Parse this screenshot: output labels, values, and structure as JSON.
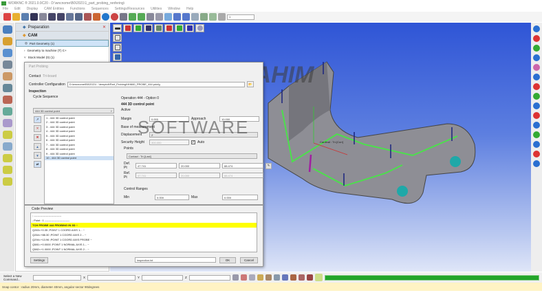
{
  "window": {
    "title": "WORKNC ® 2021.0.9C20 - D:\\wncnome\\B0\\2021\\1_part_probing_renfering\\"
  },
  "menu": [
    "File",
    "Edit",
    "Display",
    "CAM Entities",
    "Functions",
    "Sequences",
    "Settings/Resources",
    "Utilities",
    "Window",
    "Help"
  ],
  "toolbar": {
    "layer_select": "1"
  },
  "tree": {
    "preparation": "Preparation",
    "cam": "CAM",
    "items": [
      "Part Geometry (1)",
      "Geometry to machine (T) C+",
      "Stock Model (0) (1)",
      "Part Probing"
    ]
  },
  "dialog": {
    "title": "Part Probing",
    "contact_label": "Contact",
    "contact_value": "Tri-board",
    "controller_label": "Controller Configuration",
    "controller_value": "D:\\wncnome\\B0\\2021\\...\\tempinit\\Part_Probing\\HH660_PROBE_444.pdcfg",
    "inspection_label": "Inspection",
    "cycle_sequence_label": "Cycle Sequence",
    "cycle_select": "444 3D control point",
    "sequence": [
      "1 - 444 3D control point",
      "2 - 444 3D control point",
      "3 - 444 3D control point",
      "4 - 444 3D control point",
      "5 - 444 3D control point",
      "6 - 444 3D control point",
      "7 - 444 3D control point",
      "8 - 444 3D control point",
      "9 - 444 3D control point",
      "10 - 444 3D control point"
    ],
    "selected_index": 9,
    "operation": "Operation 444 - Option 0",
    "op_name": "444 3D control point",
    "active_label": "Active",
    "margin_label": "Margin",
    "margin_value": "0.000",
    "approach_label": "Approach",
    "approach_value": "10.000",
    "reference_label": "Base of measurement",
    "displacement_label": "Displacement",
    "displacement_value": "Z",
    "security_label": "Security Height",
    "security_value": "300.000",
    "auto_label": "Auto",
    "points_label": "Points",
    "points_select": "Contact : Tri-[Last]",
    "def_label": "Def. Pt",
    "def_x": "47.741",
    "def_y": "20.000",
    "def_z": "88.474",
    "ref_label": "Ref. Pt",
    "ref_x": "47.741",
    "ref_y": "20.000",
    "ref_z": "88.474",
    "ranges_label": "Control Ranges",
    "min_label": "Min",
    "min_value": "0.000",
    "max_label": "Max",
    "max_value": "0.000",
    "code_preview_label": "Code Preview",
    "code": [
      "; ------------------------------",
      "; Point : 1 ---------------------------",
      "TCH PROBE 444 PROBING IN 3D ~",
      "Q263=+0.35  ;POINT 1 COORD AXIS 1... ~",
      "Q264=+88.30  ;POINT 1 COORD AXIS 2... ~",
      "Q294=+13.96  ;POINT 1 COORD AXIS PROBE ~",
      "Q581=+0.0000  ;POINT 1 NORMAL AXIS 1... ~",
      "Q582=+1.0000  ;POINT 1 NORMAL AXIS 2... ~"
    ],
    "highlight_index": 2,
    "settings_label": "Settings",
    "output_file": "inspection.txt",
    "ok_label": "OK",
    "cancel_label": "Cancel"
  },
  "viewport": {
    "cardinal_label": "Cardinal : Tri-[Curr]"
  },
  "watermark": {
    "line1": "RAHIM",
    "line2": "SOFTWARE"
  },
  "command": {
    "select_label": "Select a New Command...",
    "x_label": "X",
    "y_label": "Y",
    "z_label": "Z"
  },
  "status": "Snap contor : radius 20mm, diameter 40mm, angular sector 90degrees",
  "colors": {
    "viewport_top": "#2f55d6",
    "progress": "#22a52a",
    "highlight": "#ffff00",
    "status_bg": "#fff3c4"
  }
}
